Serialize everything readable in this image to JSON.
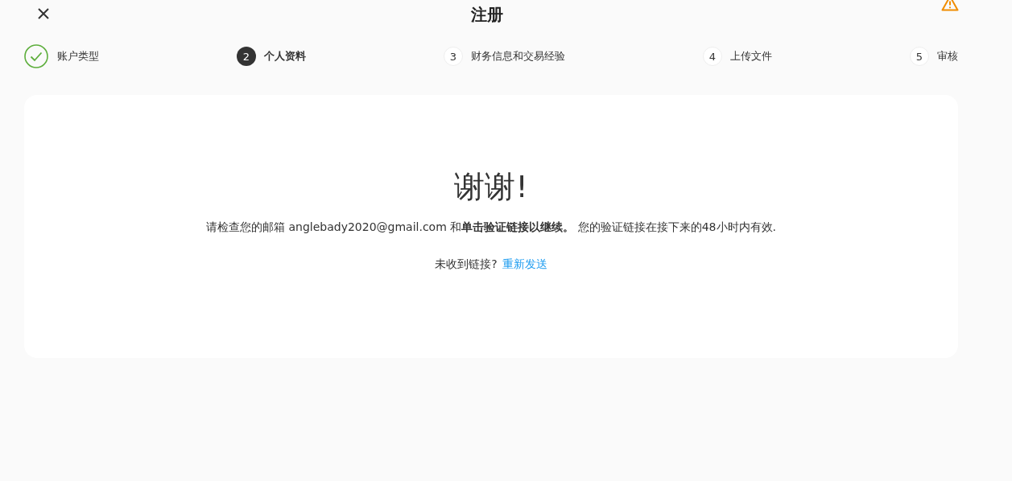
{
  "header": {
    "title": "注册"
  },
  "steps": [
    {
      "label": "账户类型",
      "completed": true,
      "selected": false
    },
    {
      "number": "2",
      "label": "个人资料",
      "completed": false,
      "selected": true
    },
    {
      "number": "3",
      "label": "财务信息和交易经验",
      "completed": false,
      "selected": false
    },
    {
      "number": "4",
      "label": "上传文件",
      "completed": false,
      "selected": false
    },
    {
      "number": "5",
      "label": "审核",
      "completed": false,
      "selected": false
    }
  ],
  "card": {
    "heading": "谢谢!",
    "message": "请检查您的邮箱 anglebady2020@gmail.com 和**单击验证链接以继续。** 您的验证链接在接下来的48小时内有效.",
    "resend_prompt": "未收到链接?",
    "resend_link": "重新发送"
  }
}
